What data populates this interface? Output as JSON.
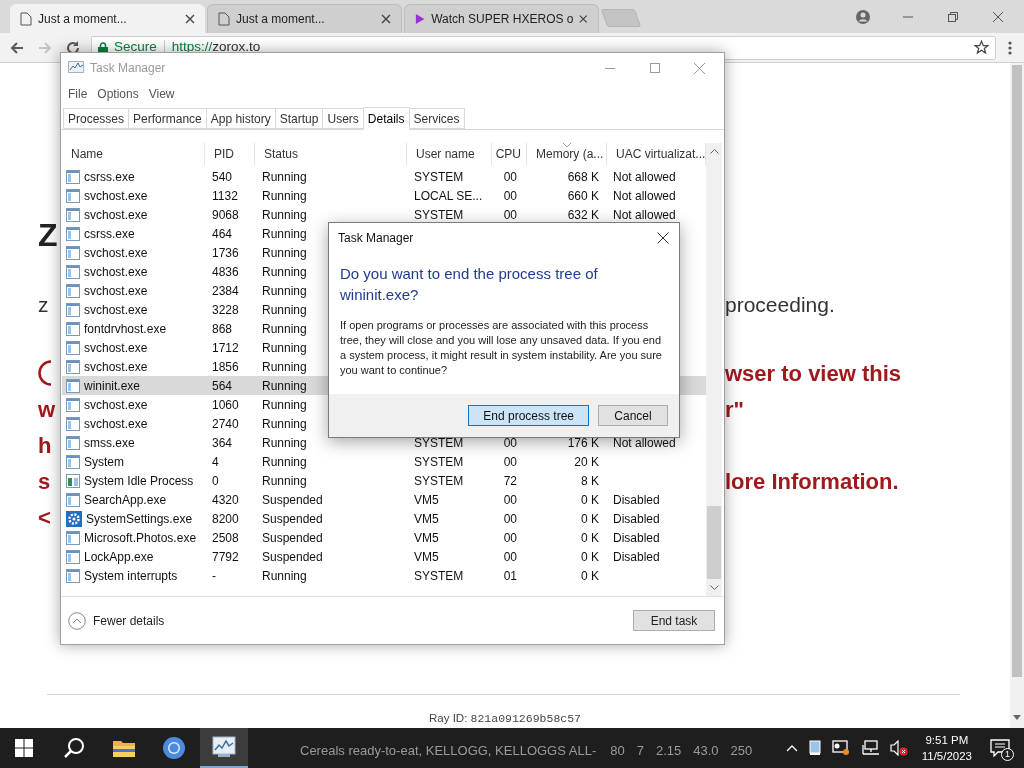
{
  "browser": {
    "tabs": [
      {
        "kind": "page",
        "title": "Just a moment...",
        "selected": true
      },
      {
        "kind": "page",
        "title": "Just a moment...",
        "selected": false
      },
      {
        "kind": "video",
        "title": "Watch SUPER HXEROS o",
        "selected": false
      }
    ],
    "nav": [
      {
        "kind": "back",
        "disabled": false
      },
      {
        "kind": "forward",
        "disabled": true
      },
      {
        "kind": "reload",
        "disabled": false
      }
    ],
    "address": {
      "security": "Secure",
      "scheme": "https://",
      "host": "zorox.to"
    }
  },
  "page": {
    "lines": [
      {
        "kind": "heading",
        "left": "Z"
      },
      {
        "kind": "text",
        "left": "z",
        "right": "proceeding."
      },
      {
        "kind": "warning-mark",
        "right": "wser to view this"
      },
      {
        "kind": "warning",
        "left": "w",
        "right": "r\""
      },
      {
        "kind": "warning",
        "left": "h"
      },
      {
        "kind": "warning",
        "left": "s",
        "right": "lore Information."
      },
      {
        "kind": "warning",
        "left": "<"
      }
    ],
    "ray_label": "Ray ID:",
    "ray_id": "821a091269b58c57"
  },
  "task_manager": {
    "title": "Task Manager",
    "menu": [
      "File",
      "Options",
      "View"
    ],
    "tabs": [
      {
        "label": "Processes",
        "selected": false
      },
      {
        "label": "Performance",
        "selected": false
      },
      {
        "label": "App history",
        "selected": false
      },
      {
        "label": "Startup",
        "selected": false
      },
      {
        "label": "Users",
        "selected": false
      },
      {
        "label": "Details",
        "selected": true
      },
      {
        "label": "Services",
        "selected": false
      }
    ],
    "columns": [
      "Name",
      "PID",
      "Status",
      "User name",
      "CPU",
      "Memory (a...",
      "UAC virtualizat..."
    ],
    "rows": [
      {
        "kind": "window",
        "name": "csrss.exe",
        "pid": "540",
        "status": "Running",
        "user": "SYSTEM",
        "cpu": "00",
        "memory": "668 K",
        "uac": "Not allowed",
        "selected": false
      },
      {
        "kind": "window",
        "name": "svchost.exe",
        "pid": "1132",
        "status": "Running",
        "user": "LOCAL SE...",
        "cpu": "00",
        "memory": "660 K",
        "uac": "Not allowed",
        "selected": false
      },
      {
        "kind": "window",
        "name": "svchost.exe",
        "pid": "9068",
        "status": "Running",
        "user": "SYSTEM",
        "cpu": "00",
        "memory": "632 K",
        "uac": "Not allowed",
        "selected": false
      },
      {
        "kind": "window",
        "name": "csrss.exe",
        "pid": "464",
        "status": "Running",
        "selected": false
      },
      {
        "kind": "window",
        "name": "svchost.exe",
        "pid": "1736",
        "status": "Running",
        "selected": false
      },
      {
        "kind": "window",
        "name": "svchost.exe",
        "pid": "4836",
        "status": "Running",
        "selected": false
      },
      {
        "kind": "window",
        "name": "svchost.exe",
        "pid": "2384",
        "status": "Running",
        "selected": false
      },
      {
        "kind": "window",
        "name": "svchost.exe",
        "pid": "3228",
        "status": "Running",
        "selected": false
      },
      {
        "kind": "window",
        "name": "fontdrvhost.exe",
        "pid": "868",
        "status": "Running",
        "selected": false
      },
      {
        "kind": "window",
        "name": "svchost.exe",
        "pid": "1712",
        "status": "Running",
        "selected": false
      },
      {
        "kind": "window",
        "name": "svchost.exe",
        "pid": "1856",
        "status": "Running",
        "selected": false
      },
      {
        "kind": "window",
        "name": "wininit.exe",
        "pid": "564",
        "status": "Running",
        "selected": true
      },
      {
        "kind": "window",
        "name": "svchost.exe",
        "pid": "1060",
        "status": "Running",
        "selected": false
      },
      {
        "kind": "window",
        "name": "svchost.exe",
        "pid": "2740",
        "status": "Running",
        "selected": false
      },
      {
        "kind": "window",
        "name": "smss.exe",
        "pid": "364",
        "status": "Running",
        "user": "SYSTEM",
        "cpu": "00",
        "memory": "176 K",
        "uac": "Not allowed",
        "selected": false
      },
      {
        "kind": "window",
        "name": "System",
        "pid": "4",
        "status": "Running",
        "user": "SYSTEM",
        "cpu": "00",
        "memory": "20 K",
        "selected": false
      },
      {
        "kind": "idle",
        "name": "System Idle Process",
        "pid": "0",
        "status": "Running",
        "user": "SYSTEM",
        "cpu": "72",
        "memory": "8 K",
        "selected": false
      },
      {
        "kind": "window",
        "name": "SearchApp.exe",
        "pid": "4320",
        "status": "Suspended",
        "user": "VM5",
        "cpu": "00",
        "memory": "0 K",
        "uac": "Disabled",
        "selected": false
      },
      {
        "kind": "gear",
        "name": "SystemSettings.exe",
        "pid": "8200",
        "status": "Suspended",
        "user": "VM5",
        "cpu": "00",
        "memory": "0 K",
        "uac": "Disabled",
        "selected": false
      },
      {
        "kind": "window",
        "name": "Microsoft.Photos.exe",
        "pid": "2508",
        "status": "Suspended",
        "user": "VM5",
        "cpu": "00",
        "memory": "0 K",
        "uac": "Disabled",
        "selected": false
      },
      {
        "kind": "window",
        "name": "LockApp.exe",
        "pid": "7792",
        "status": "Suspended",
        "user": "VM5",
        "cpu": "00",
        "memory": "0 K",
        "uac": "Disabled",
        "selected": false
      },
      {
        "kind": "window",
        "name": "System interrupts",
        "pid": "-",
        "status": "Running",
        "user": "SYSTEM",
        "cpu": "01",
        "memory": "0 K",
        "selected": false
      }
    ],
    "fewer_details": "Fewer details",
    "end_task": "End task"
  },
  "dialog": {
    "title": "Task Manager",
    "heading": "Do you want to end the process tree of wininit.exe?",
    "body": "If open programs or processes are associated with this process tree, they will close and you will lose any unsaved data. If you end a system process, it might result in system instability. Are you sure you want to continue?",
    "buttons": [
      {
        "label": "End process tree",
        "default": true
      },
      {
        "label": "Cancel",
        "default": false
      }
    ]
  },
  "taskbar": {
    "apps": [
      {
        "kind": "start",
        "active": false
      },
      {
        "kind": "search",
        "active": false
      },
      {
        "kind": "explorer",
        "active": false
      },
      {
        "kind": "chrome",
        "active": false
      },
      {
        "kind": "taskmgr",
        "active": true
      }
    ],
    "overlay_text": "Cereals ready-to-eat, KELLOGG, KELLOGGS ALL-",
    "overlay_numbers": [
      "80",
      "7",
      "2.15",
      "43.0",
      "250"
    ],
    "time": "9:51 PM",
    "date": "11/5/2023",
    "notifications": "1"
  }
}
